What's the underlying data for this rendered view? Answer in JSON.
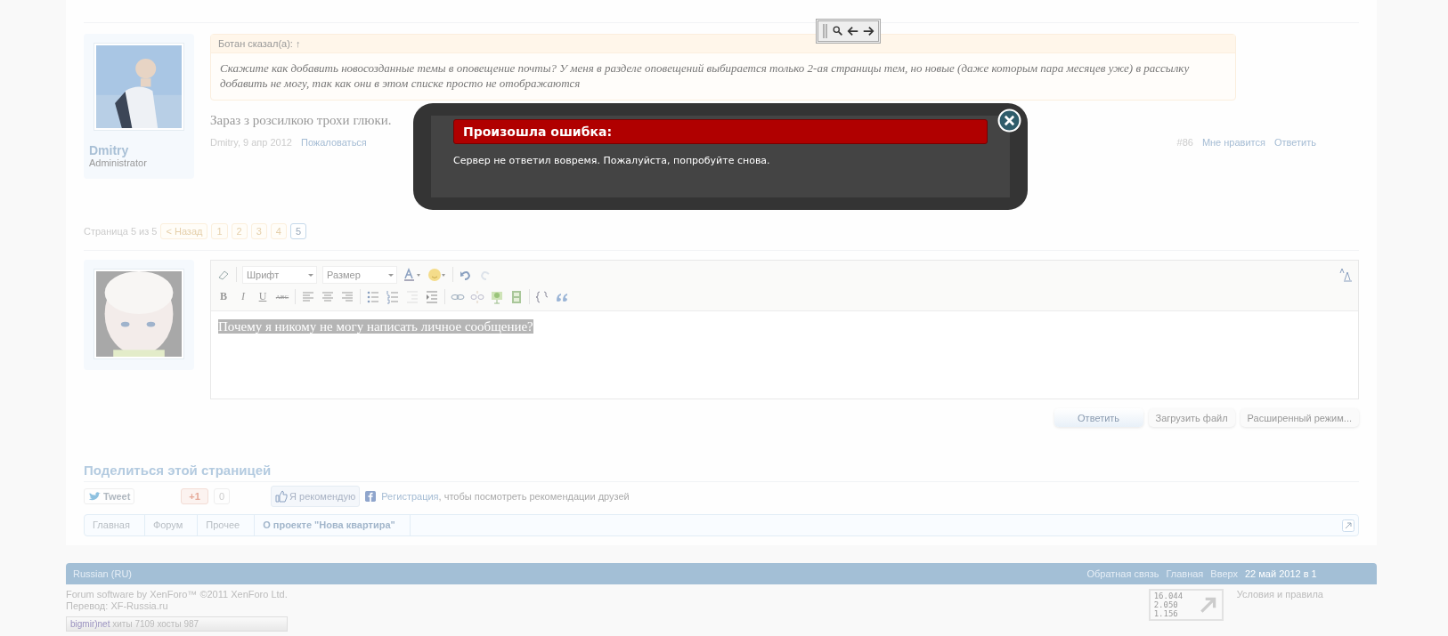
{
  "post": {
    "author": "Dmitry",
    "role": "Administrator",
    "quote": {
      "attribution": "Ботан сказал(а): ↑",
      "text": "Скажите как добавить новосозданные темы в оповещение почты? У меня в разделе оповещений выбирается только 2-ая страницы тем, но новые (даже которым пара месяцев уже) в рассылку добавить не могу, так как они в этом списке просто не отображаются"
    },
    "message": "Зараз з розсилкою трохи глюки.",
    "meta_author": "Dmitry",
    "meta_date": ", 9 апр 2012",
    "report": "Пожаловаться",
    "number": "#86",
    "like": "Мне нравится",
    "reply": "Ответить"
  },
  "pagination": {
    "label": "Страница 5 из 5",
    "prev": "< Назад",
    "pages": [
      {
        "label": "1",
        "selected": false
      },
      {
        "label": "2",
        "selected": false
      },
      {
        "label": "3",
        "selected": false
      },
      {
        "label": "4",
        "selected": false
      },
      {
        "label": "5",
        "selected": true
      }
    ]
  },
  "editor": {
    "font": "Шрифт",
    "size": "Размер",
    "format_buttons": [
      "B",
      "I",
      "U",
      "ABC"
    ],
    "text": "Почему я никому не могу написать личное сообщение?"
  },
  "buttons": [
    "Ответить",
    "Загрузить файл",
    "Расширенный режим..."
  ],
  "share": {
    "title": "Поделиться этой страницей",
    "tweet": "Tweet",
    "plus_one": "+1",
    "plus_count": "0",
    "recommend": "Я рекомендую",
    "register_link": "Регистрация",
    "register_text": ", чтобы посмотреть рекомендации друзей"
  },
  "breadcrumbs": [
    {
      "label": "Главная",
      "current": false
    },
    {
      "label": "Форум",
      "current": false
    },
    {
      "label": "Прочее",
      "current": false
    },
    {
      "label": "О проекте \"Нова квартира\"",
      "current": true
    }
  ],
  "footer": {
    "language": "Russian (RU)",
    "links": [
      "Обратная связь",
      "Главная",
      "Вверх"
    ],
    "date": "22 май 2012 в 1",
    "copyright": "Forum software by XenForo™ ©2011 XenForo Ltd.",
    "translation": "Перевод: XF-Russia.ru",
    "terms": "Условия и правила",
    "stats": [
      "16.044",
      "2.050",
      "1.156"
    ],
    "counter": {
      "brand": "bigmir)net",
      "label": "хиты 7109 хосты 987"
    }
  },
  "error_dialog": {
    "title": "Произошла ошибка:",
    "message": "Сервер не ответил вовремя. Пожалуйста, попробуйте снова."
  }
}
